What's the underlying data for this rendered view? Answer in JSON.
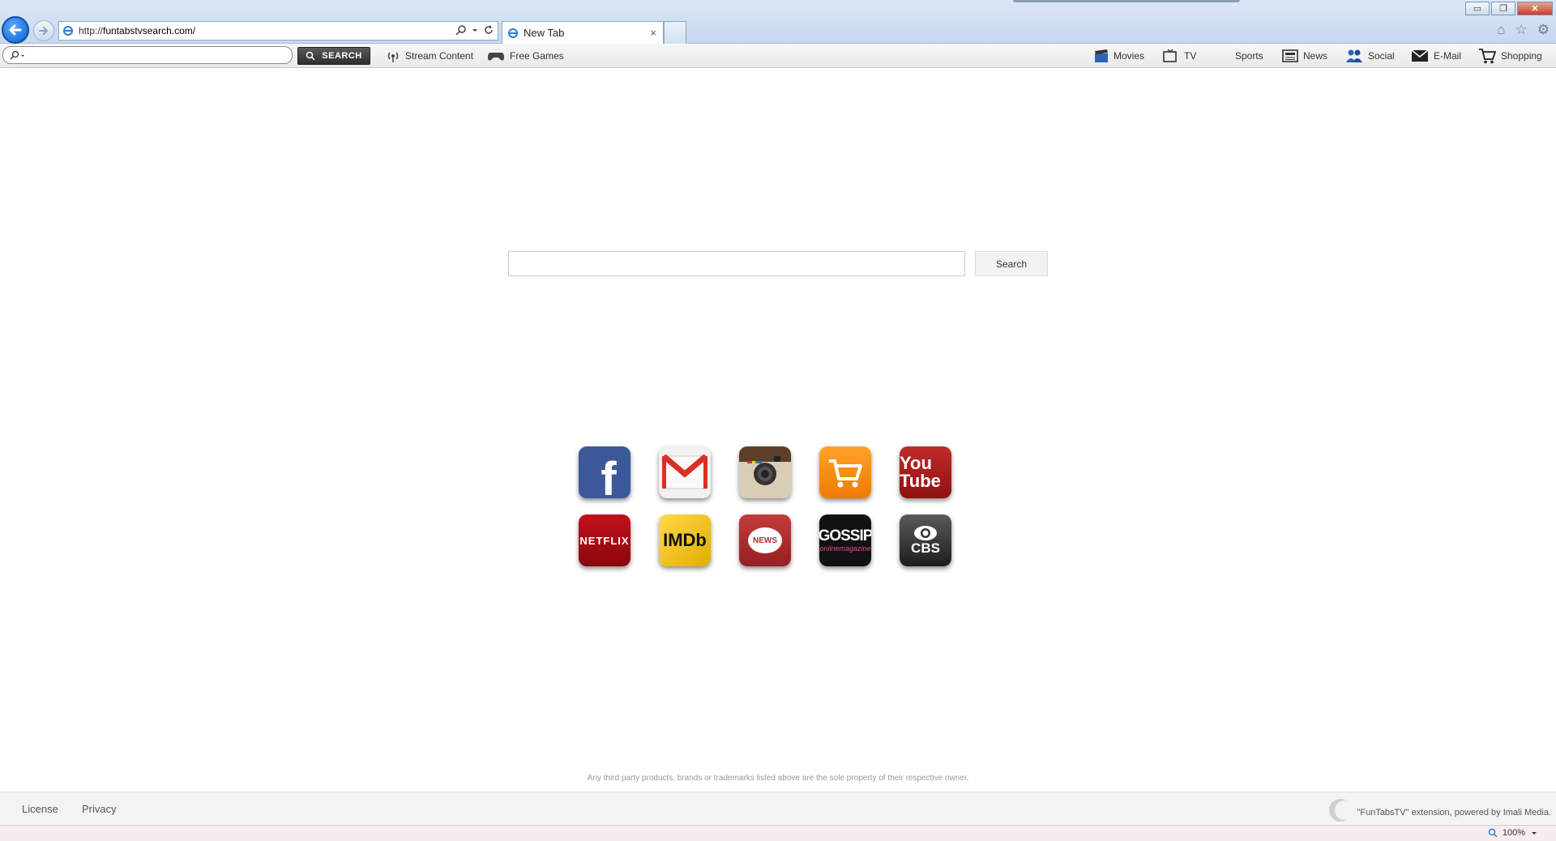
{
  "browser": {
    "url_prefix": "http://",
    "url_domain": "funtabstvsearch.com/",
    "tab_title": "New Tab",
    "tab_close": "×",
    "window_buttons": [
      "▭",
      "❐",
      "✕"
    ],
    "right_icons": [
      "home-icon",
      "star-icon",
      "gear-icon"
    ]
  },
  "toolbar": {
    "search_placeholder": "",
    "search_button": "SEARCH",
    "stream_label": "Stream Content",
    "games_label": "Free Games",
    "nav": [
      {
        "label": "Movies",
        "icon": "clapperboard-icon"
      },
      {
        "label": "TV",
        "icon": "tv-icon"
      },
      {
        "label": "Sports",
        "icon": "sports-icon"
      },
      {
        "label": "News",
        "icon": "newspaper-icon"
      },
      {
        "label": "Social",
        "icon": "people-icon"
      },
      {
        "label": "E-Mail",
        "icon": "envelope-icon"
      },
      {
        "label": "Shopping",
        "icon": "cart-icon"
      }
    ]
  },
  "main": {
    "search_value": "",
    "search_button": "Search",
    "tiles": [
      {
        "name": "facebook",
        "text": "f",
        "bg": "#3b5998"
      },
      {
        "name": "gmail",
        "text": "M",
        "bg": "#f1f1f1"
      },
      {
        "name": "instagram",
        "text": "",
        "bg": "#b8a384"
      },
      {
        "name": "shopping",
        "text": "",
        "bg": "#f08300"
      },
      {
        "name": "youtube",
        "text": "You Tube",
        "bg": "#b22222"
      },
      {
        "name": "netflix",
        "text": "NETFLIX",
        "bg": "#b20710"
      },
      {
        "name": "imdb",
        "text": "IMDb",
        "bg": "#f5c518"
      },
      {
        "name": "news",
        "text": "NEWS",
        "bg": "#b02b2b"
      },
      {
        "name": "gossip",
        "text": "GOSSIP",
        "subtext": "onlinemagazine",
        "bg": "#111111"
      },
      {
        "name": "cbs",
        "text": "CBS",
        "bg": "#2b2b2b"
      }
    ],
    "disclaimer": "Any third party products, brands or trademarks listed above are the sole property of their respective owner."
  },
  "footer": {
    "license": "License",
    "privacy": "Privacy",
    "credit": "\"FunTabsTV\" extension, powered by Imali Media."
  },
  "status": {
    "zoom": "100%"
  }
}
